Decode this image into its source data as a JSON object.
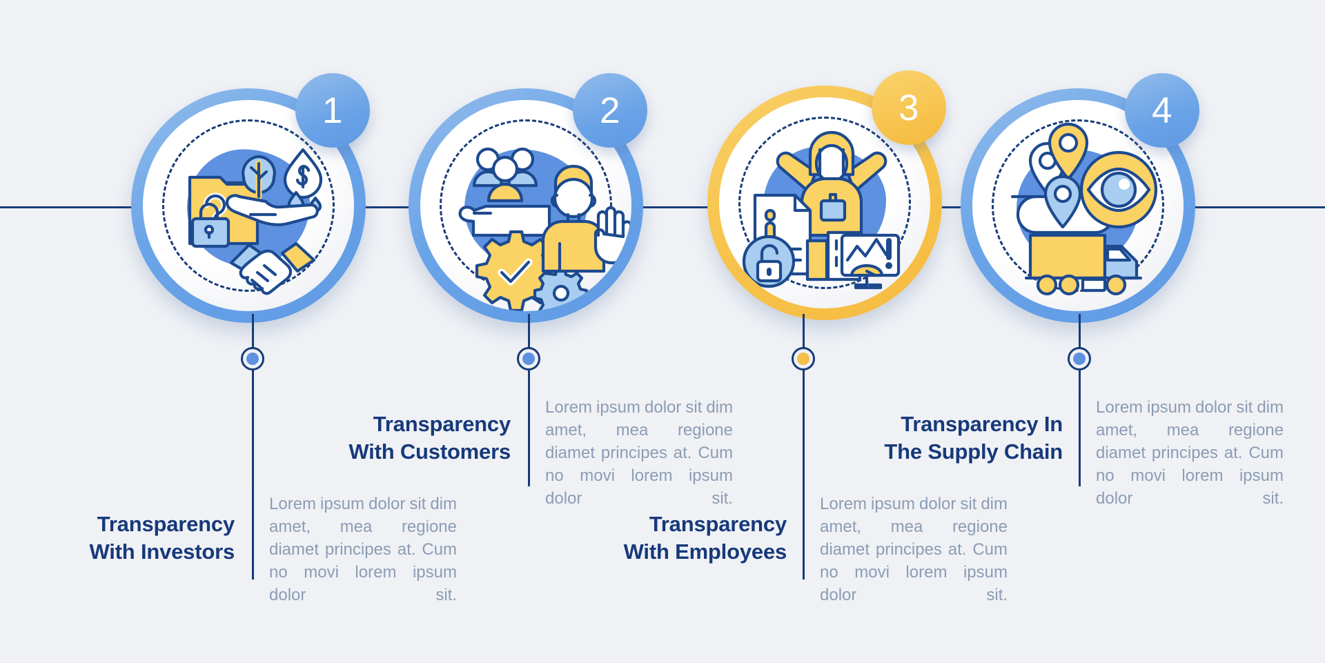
{
  "theme": {
    "background": "#eff1f5",
    "navy": "#17397a",
    "line": "#173c78",
    "blue": "#5e91e0",
    "blue_light": "#92bcea",
    "gold": "#f5c04a",
    "gold_light": "#f9d36e",
    "muted_text": "#8d9cb4"
  },
  "steps": [
    {
      "number": "1",
      "accent": "blue",
      "title": "Transparency\nWith Investors",
      "description": "Lorem ipsum dolor sit dim amet, mea regione diamet principes at. Cum no movi lorem ipsum dolor sit.",
      "icon": "handshake-documents-icon",
      "icon_elements": [
        "folder-icon",
        "padlock-icon",
        "question-mark-icon",
        "tree-icon",
        "hand-icon",
        "dollar-droplet-icon",
        "handshake-icon"
      ]
    },
    {
      "number": "2",
      "accent": "blue",
      "title": "Transparency\nWith Customers",
      "description": "Lorem ipsum dolor sit dim amet, mea regione diamet principes at. Cum no movi lorem ipsum dolor sit.",
      "icon": "customer-service-icon",
      "icon_elements": [
        "people-group-icon",
        "open-hand-icon",
        "gear-check-icon",
        "gear-icon",
        "waving-person-icon"
      ]
    },
    {
      "number": "3",
      "accent": "gold",
      "title": "Transparency\nWith Employees",
      "description": "Lorem ipsum dolor sit dim amet, mea regione diamet principes at. Cum no movi lorem ipsum dolor sit.",
      "icon": "employee-openness-icon",
      "icon_elements": [
        "person-arms-raised-icon",
        "id-badge-icon",
        "document-info-icon",
        "unlock-icon",
        "chart-monitor-icon",
        "alert-icon"
      ]
    },
    {
      "number": "4",
      "accent": "blue",
      "title": "Transparency In\nThe Supply Chain",
      "description": "Lorem ipsum dolor sit dim amet, mea regione diamet principes at. Cum no movi lorem ipsum dolor sit.",
      "icon": "supply-chain-icon",
      "icon_elements": [
        "map-pin-icon",
        "eye-icon",
        "delivery-truck-icon"
      ]
    }
  ]
}
